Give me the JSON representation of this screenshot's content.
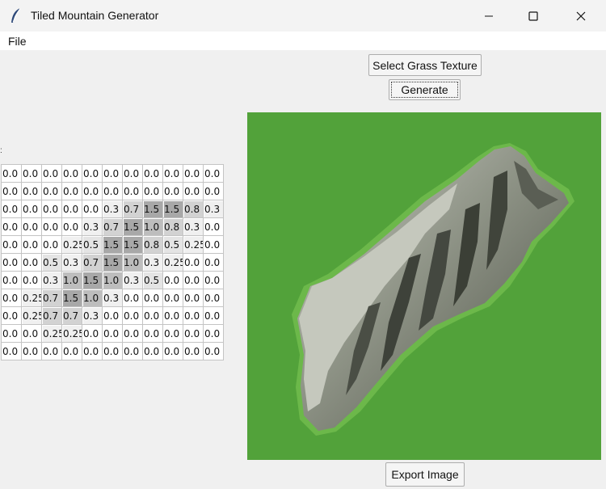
{
  "window": {
    "title": "Tiled Mountain Generator"
  },
  "menu": {
    "file": "File"
  },
  "buttons": {
    "select_grass": "Select Grass Texture",
    "generate": "Generate",
    "export": "Export Image"
  },
  "colors": {
    "grass": "#52a23a",
    "rock_light": "#a9aea0",
    "rock_dark": "#3b3f36"
  },
  "heightmap": [
    [
      "0.0",
      "0.0",
      "0.0",
      "0.0",
      "0.0",
      "0.0",
      "0.0",
      "0.0",
      "0.0",
      "0.0",
      "0.0"
    ],
    [
      "0.0",
      "0.0",
      "0.0",
      "0.0",
      "0.0",
      "0.0",
      "0.0",
      "0.0",
      "0.0",
      "0.0",
      "0.0"
    ],
    [
      "0.0",
      "0.0",
      "0.0",
      "0.0",
      "0.0",
      "0.3",
      "0.7",
      "1.5",
      "1.5",
      "0.8",
      "0.3"
    ],
    [
      "0.0",
      "0.0",
      "0.0",
      "0.0",
      "0.3",
      "0.7",
      "1.5",
      "1.0",
      "0.8",
      "0.3",
      "0.0"
    ],
    [
      "0.0",
      "0.0",
      "0.0",
      "0.25",
      "0.5",
      "1.5",
      "1.5",
      "0.8",
      "0.5",
      "0.25",
      "0.0"
    ],
    [
      "0.0",
      "0.0",
      "0.5",
      "0.3",
      "0.7",
      "1.5",
      "1.0",
      "0.3",
      "0.25",
      "0.0",
      "0.0"
    ],
    [
      "0.0",
      "0.0",
      "0.3",
      "1.0",
      "1.5",
      "1.0",
      "0.3",
      "0.5",
      "0.0",
      "0.0",
      "0.0"
    ],
    [
      "0.0",
      "0.25",
      "0.7",
      "1.5",
      "1.0",
      "0.3",
      "0.0",
      "0.0",
      "0.0",
      "0.0",
      "0.0"
    ],
    [
      "0.0",
      "0.25",
      "0.7",
      "0.7",
      "0.3",
      "0.0",
      "0.0",
      "0.0",
      "0.0",
      "0.0",
      "0.0"
    ],
    [
      "0.0",
      "0.0",
      "0.25",
      "0.25",
      "0.0",
      "0.0",
      "0.0",
      "0.0",
      "0.0",
      "0.0",
      "0.0"
    ],
    [
      "0.0",
      "0.0",
      "0.0",
      "0.0",
      "0.0",
      "0.0",
      "0.0",
      "0.0",
      "0.0",
      "0.0",
      "0.0"
    ]
  ]
}
